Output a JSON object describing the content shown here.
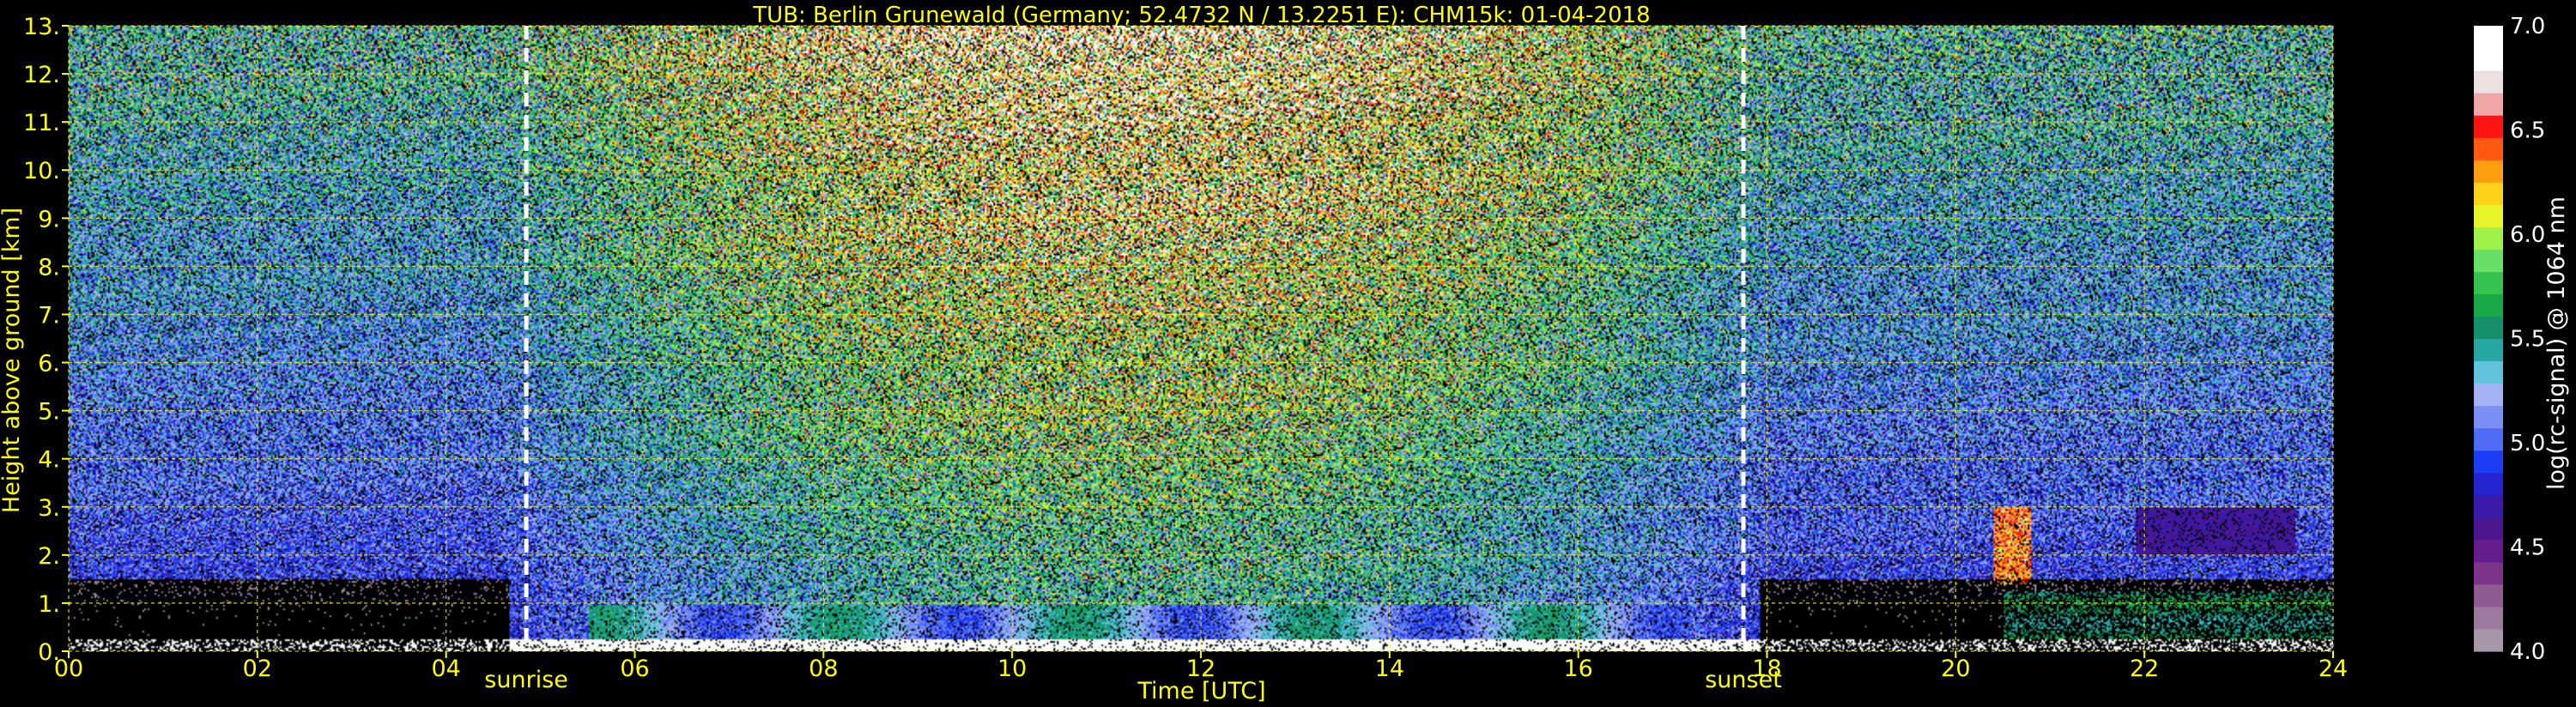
{
  "chart_data": {
    "type": "heatmap",
    "title": "TUB: Berlin Grunewald (Germany; 52.4732 N / 13.2251 E):    CHM15k: 01-04-2018",
    "xlabel": "Time [UTC]",
    "ylabel": "Height above ground [km]",
    "xlim": [
      0,
      24
    ],
    "ylim": [
      0,
      13
    ],
    "x_ticks": [
      "00",
      "02",
      "04",
      "06",
      "08",
      "10",
      "12",
      "14",
      "16",
      "18",
      "20",
      "22",
      "24"
    ],
    "y_ticks": [
      "0.",
      "1.",
      "2.",
      "3.",
      "4.",
      "5.",
      "6.",
      "7.",
      "8.",
      "9.",
      "10.",
      "11.",
      "12.",
      "13."
    ],
    "grid": true,
    "grid_color": "#ffff00",
    "text_color": "#ffff00",
    "background": "#000000",
    "annotations": [
      {
        "label": "sunrise",
        "x": 4.85
      },
      {
        "label": "sunset",
        "x": 17.75
      }
    ],
    "colorbar": {
      "label": "log(rc-signal) @ 1064 nm",
      "range": [
        4.0,
        7.0
      ],
      "tick_labels": [
        "4.0",
        "4.5",
        "5.0",
        "5.5",
        "6.0",
        "6.5",
        "7.0"
      ],
      "colors": [
        "#a797aa",
        "#9c7a9e",
        "#8f5c92",
        "#7c3589",
        "#651d8c",
        "#4b168f",
        "#3a1aa8",
        "#2424d0",
        "#1c3cf5",
        "#4f6cf7",
        "#7b8ff5",
        "#a7b2f5",
        "#62c4dc",
        "#27a6a4",
        "#14906a",
        "#17a84a",
        "#35c24e",
        "#66e066",
        "#9ff24a",
        "#e8f52a",
        "#ffd21a",
        "#ff9d10",
        "#ff5a10",
        "#ff1414",
        "#f2a7a7",
        "#ede0e0",
        "#ffffff",
        "#ffffff"
      ]
    },
    "features": {
      "surface_layer_top_km": 0.25,
      "daytime_boundary_layer_top_km": 0.95,
      "evening_aerosol_layer_top_km": 1.25,
      "night_residual_layer_km": [
        2.0,
        3.0
      ],
      "cloud_patch": {
        "x": [
          20.4,
          20.8
        ],
        "y_km": [
          1.4,
          3.0
        ]
      }
    }
  }
}
